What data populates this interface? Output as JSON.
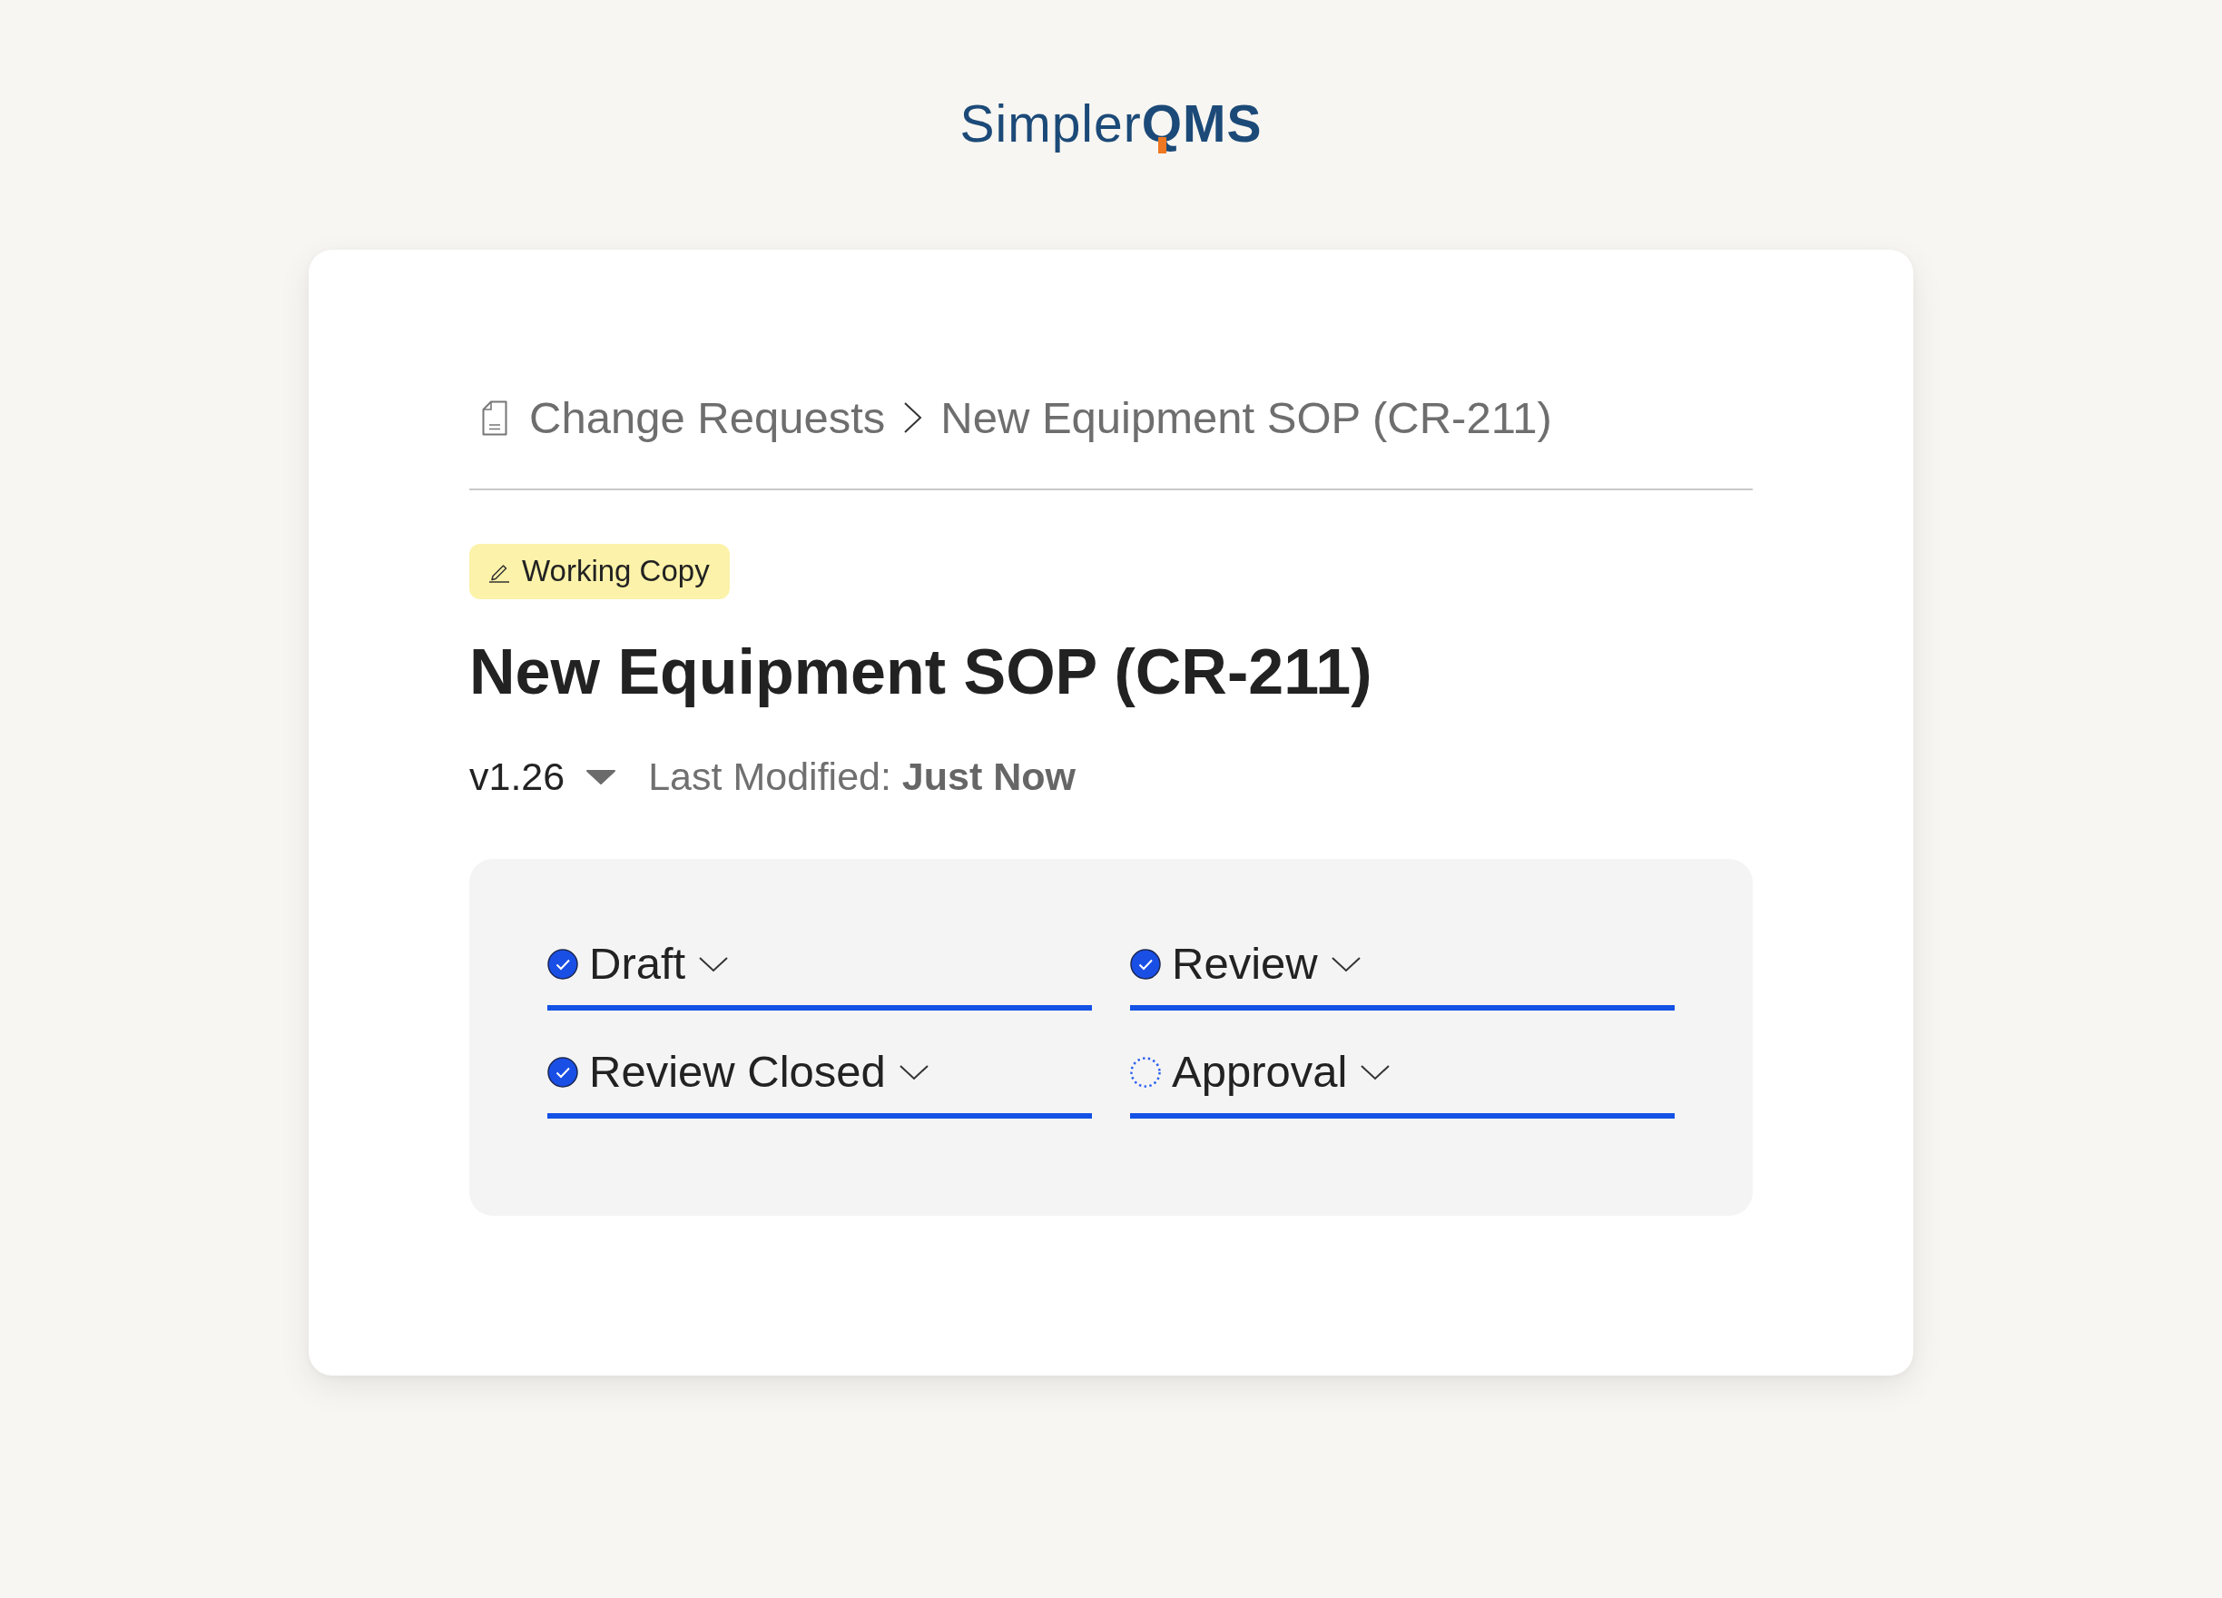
{
  "logo": {
    "text": "Simpler**QMS**"
  },
  "breadcrumb": {
    "items": [
      {
        "label": "Change Requests"
      },
      {
        "label": "New Equipment SOP (CR-211)"
      }
    ]
  },
  "badge": {
    "label": "Working Copy"
  },
  "title": "New Equipment SOP (CR-211)",
  "version": {
    "label": "v1.26"
  },
  "last_modified": "Last Modified: **Just Now**",
  "stages": [
    {
      "label": "Draft",
      "completed": true
    },
    {
      "label": "Review",
      "completed": true
    },
    {
      "label": "Review Closed",
      "completed": true
    },
    {
      "label": "Approval",
      "completed": false
    }
  ]
}
